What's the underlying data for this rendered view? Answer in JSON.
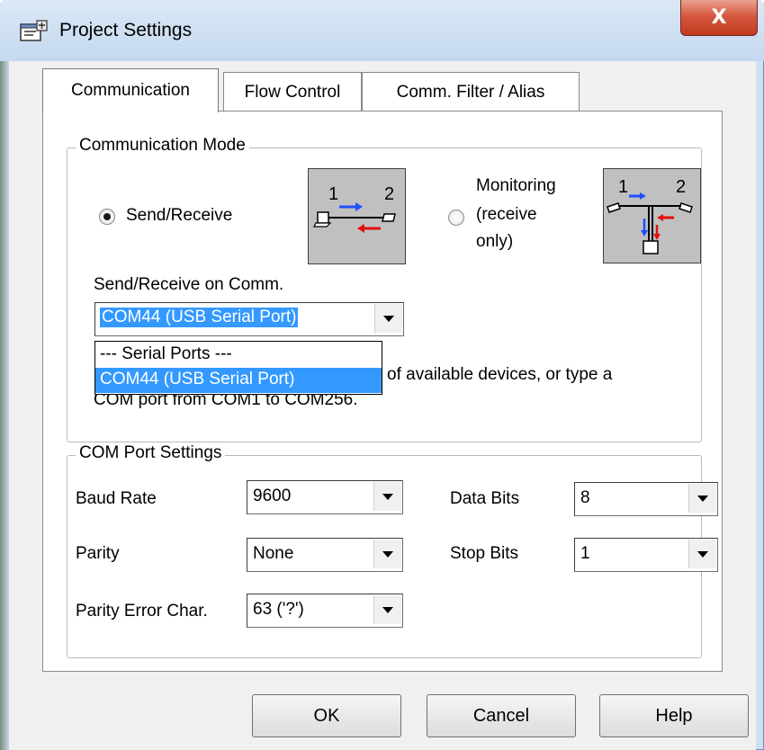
{
  "window": {
    "title": "Project Settings",
    "close_label": "X"
  },
  "tabs": [
    {
      "label": "Communication",
      "active": true
    },
    {
      "label": "Flow Control",
      "active": false
    },
    {
      "label": "Comm. Filter / Alias",
      "active": false
    }
  ],
  "communication_mode": {
    "title": "Communication Mode",
    "send_receive_label": "Send/Receive",
    "send_receive_selected": true,
    "monitoring_label_line1": "Monitoring",
    "monitoring_label_line2": "(receive",
    "monitoring_label_line3": "only)",
    "monitoring_selected": false,
    "diagram_send": {
      "port1": "1",
      "port2": "2"
    },
    "diagram_monitor": {
      "port1": "1",
      "port2": "2"
    },
    "send_receive_on_label": "Send/Receive on Comm.",
    "comm_combo_value": "COM44  (USB Serial Port)",
    "dropdown_items": [
      "--- Serial Ports ---",
      "COM44  (USB Serial Port)"
    ],
    "dropdown_selected_index": 1,
    "hint_tail_line1": "of available devices, or type a",
    "hint_line2": "COM port from COM1 to COM256."
  },
  "com_port_settings": {
    "title": "COM Port Settings",
    "baud_rate_label": "Baud Rate",
    "baud_rate_value": "9600",
    "data_bits_label": "Data Bits",
    "data_bits_value": "8",
    "parity_label": "Parity",
    "parity_value": "None",
    "stop_bits_label": "Stop Bits",
    "stop_bits_value": "1",
    "parity_error_label": "Parity Error Char.",
    "parity_error_value": "63 ('?')"
  },
  "buttons": {
    "ok": "OK",
    "cancel": "Cancel",
    "help": "Help"
  },
  "colors": {
    "selection": "#3399ff",
    "arrow_blue": "#1f4fff",
    "arrow_red": "#e01010",
    "close_red": "#c0391f"
  }
}
